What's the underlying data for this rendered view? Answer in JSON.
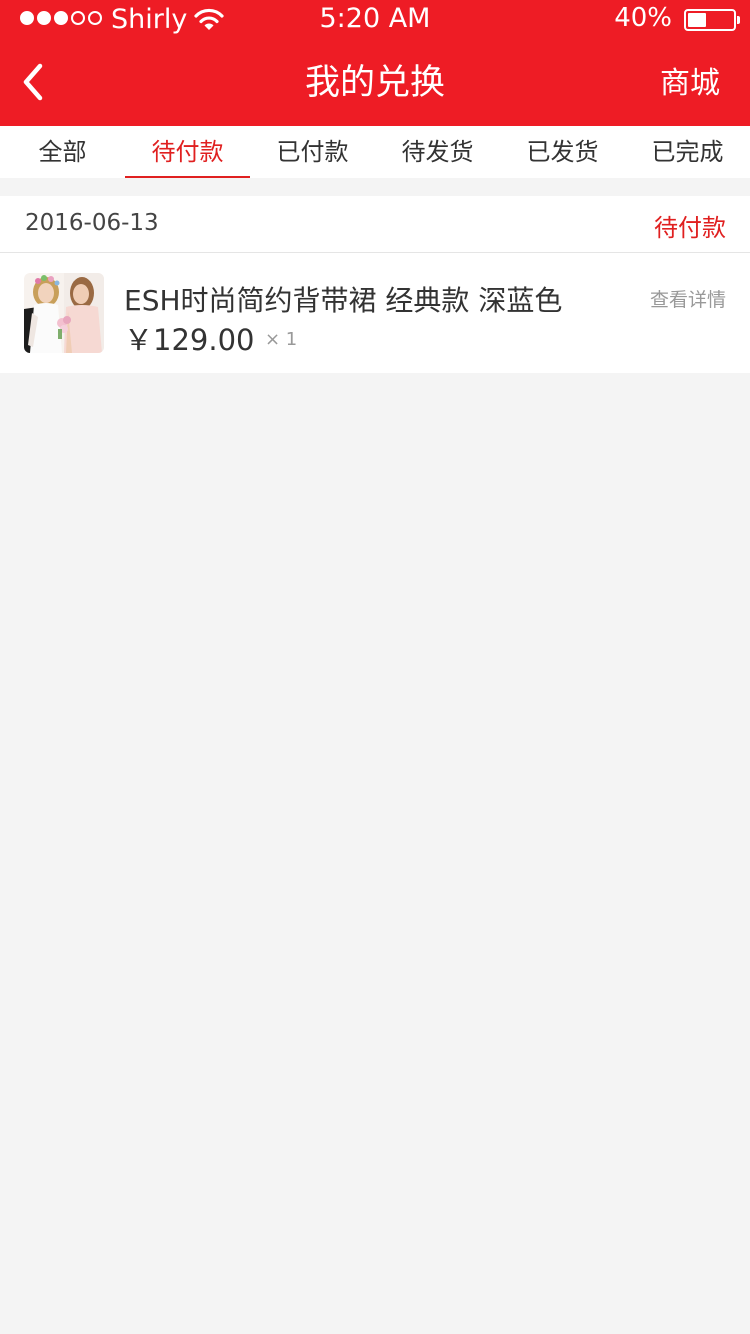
{
  "status_bar": {
    "carrier": "Shirly",
    "time": "5:20 AM",
    "battery_percent": "40%",
    "battery_level": 0.4,
    "signal_bars_filled": 3,
    "signal_bars_total": 5
  },
  "nav": {
    "back_icon": "chevron-left-icon",
    "title": "我的兑换",
    "shop_label": "商城",
    "brand_color": "#ee1c25"
  },
  "tabs": [
    {
      "label": "全部",
      "active": false
    },
    {
      "label": "待付款",
      "active": true
    },
    {
      "label": "已付款",
      "active": false
    },
    {
      "label": "待发货",
      "active": false
    },
    {
      "label": "已发货",
      "active": false
    },
    {
      "label": "已完成",
      "active": false
    }
  ],
  "orders": [
    {
      "date": "2016-06-13",
      "status": "待付款",
      "items": [
        {
          "name": "ESH时尚简约背带裙 经典款 深蓝色",
          "price": "￥129.00",
          "quantity": "× 1",
          "detail_label": "查看详情"
        }
      ]
    }
  ],
  "colors": {
    "accent": "#e02020",
    "page_background": "#f4f4f4"
  }
}
